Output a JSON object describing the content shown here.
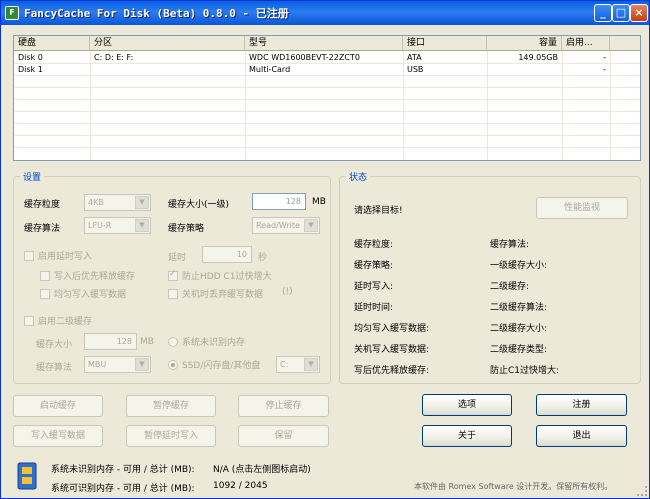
{
  "window": {
    "title": "FancyCache For Disk (Beta) 0.8.0 - 已注册",
    "app_icon": "fc-app-icon",
    "controls": {
      "minimize": "_",
      "maximize": "□",
      "close": "×"
    }
  },
  "disk_list": {
    "columns": [
      "硬盘",
      "分区",
      "型号",
      "接口",
      "容量",
      "启用..."
    ],
    "rows": [
      [
        "Disk 0",
        "C: D: E: F:",
        "WDC WD1600BEVT-22ZCT0",
        "ATA",
        "149.05GB",
        "-"
      ],
      [
        "Disk 1",
        "",
        "Multi-Card",
        "USB",
        "",
        "-"
      ]
    ]
  },
  "settings": {
    "title": "设置",
    "granularity_label": "缓存粒度",
    "granularity_value": "4KB",
    "algorithm_label": "缓存算法",
    "algorithm_value": "LFU-R",
    "l1_size_label": "缓存大小(一级)",
    "l1_size_value": "128",
    "l1_size_unit": "MB",
    "policy_label": "缓存策略",
    "policy_value": "Read/Write",
    "deferred_write_label": "启用延时写入",
    "latency_label": "延时",
    "latency_value": "10",
    "latency_unit": "秒",
    "flush_priority_label": "写入后优先释放缓存",
    "prevent_hdd_label": "防止HDD C1过快增大",
    "even_write_label": "均匀写入缓写数据",
    "discard_on_shutdown_label": "关机时丢弃缓写数据",
    "discard_hint": "(!)",
    "l2_enable_label": "启用二级缓存",
    "l2_size_label": "缓存大小",
    "l2_size_value": "128",
    "l2_size_unit": "MB",
    "l2_algorithm_label": "缓存算法",
    "l2_algorithm_value": "MBU",
    "unrecognized_mem_label": "系统未识别内存",
    "ssd_label": "SSD/闪存盘/其他盘",
    "ssd_drive_value": "C:"
  },
  "status": {
    "title": "状态",
    "prompt": "请选择目标!",
    "perf_monitor_label": "性能监视",
    "left_fields": [
      "缓存粒度:",
      "缓存策略:",
      "延时写入:",
      "延时时间:",
      "均匀写入缓写数据:",
      "关机写入缓写数据:",
      "写后优先释放缓存:"
    ],
    "right_fields": [
      "缓存算法:",
      "一级缓存大小:",
      "二级缓存:",
      "二级缓存算法:",
      "二级缓存大小:",
      "二级缓存类型:",
      "防止C1过快增大:"
    ]
  },
  "actions": {
    "start_cache": "启动缓存",
    "pause_cache": "暂停缓存",
    "stop_cache": "停止缓存",
    "write_deferred": "写入缓写数据",
    "pause_deferred": "暂停延时写入",
    "save": "保留",
    "options": "选项",
    "register": "注册",
    "about": "关于",
    "exit": "退出"
  },
  "footer": {
    "unrecognized_mem_label": "系统未识别内存 - 可用 / 总计 (MB):",
    "unrecognized_mem_value": "N/A (点击左侧图标启动)",
    "recognized_mem_label": "系统可识别内存 - 可用 / 总计 (MB):",
    "recognized_mem_value": "1092 / 2045",
    "copyright": "本软件由 Romex Software 设计开发。保留所有权利。",
    "memory_icon": "memory-chip-icon"
  }
}
